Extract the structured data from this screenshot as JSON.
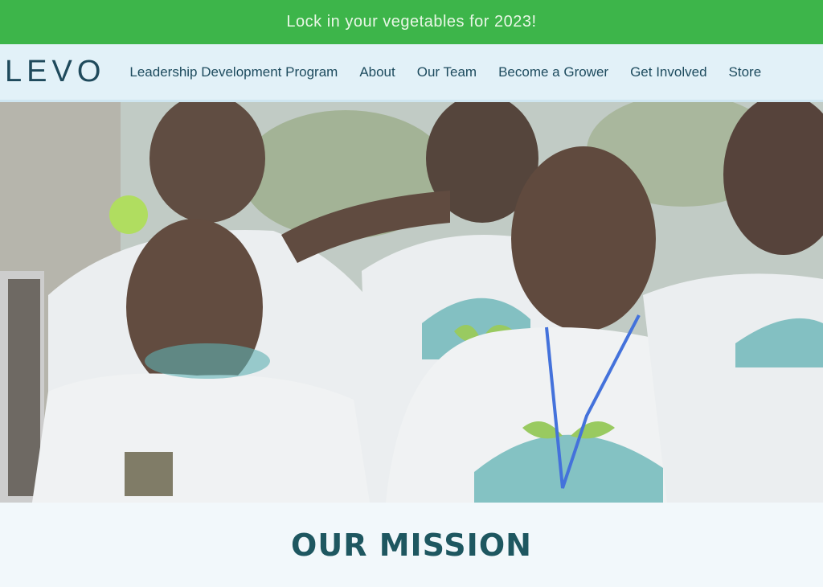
{
  "banner": {
    "text": "Lock in your vegetables for 2023!"
  },
  "brand": {
    "logo": "LEVO"
  },
  "nav": {
    "items": [
      "Leadership Development Program",
      "About",
      "Our Team",
      "Become a Grower",
      "Get Involved",
      "Store"
    ]
  },
  "hero": {
    "scroll_icon": "chevron-down-icon"
  },
  "mission": {
    "heading": "OUR MISSION"
  },
  "colors": {
    "banner": "#3db54a",
    "nav_bg": "#e2f1f8",
    "heading": "#1e5760",
    "teal": "#4aa7a8",
    "leaf": "#8bc34a"
  }
}
